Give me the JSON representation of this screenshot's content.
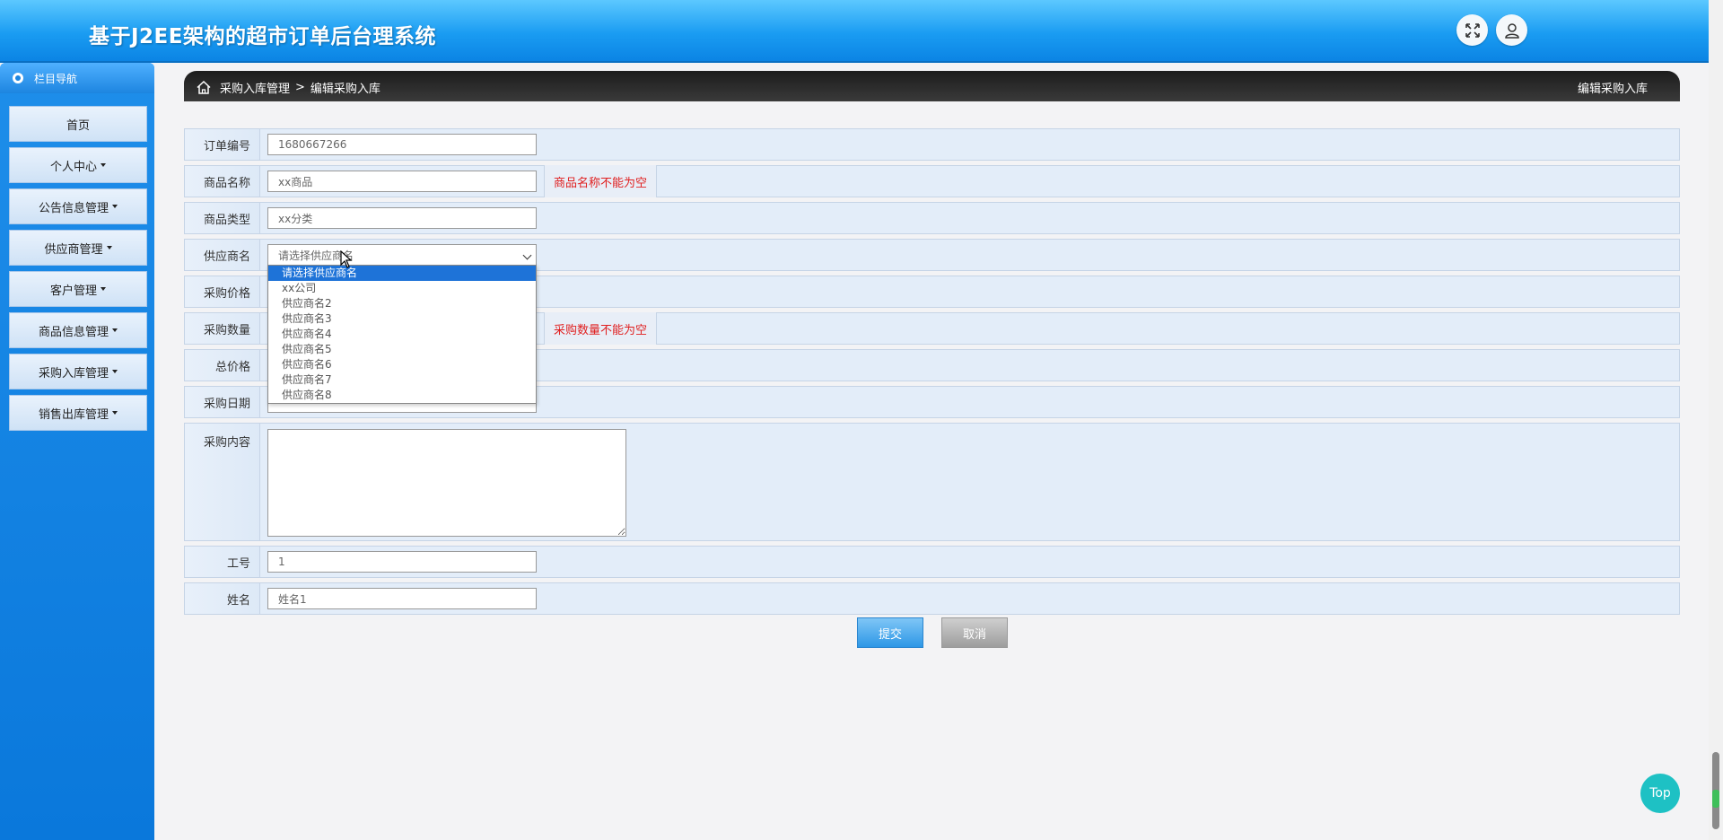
{
  "header": {
    "title": "基于J2EE架构的超市订单后台理系统",
    "fullscreen_icon": "expand-icon",
    "user_icon": "user-icon"
  },
  "sidebar": {
    "nav_title": "栏目导航",
    "items": [
      {
        "label": "首页",
        "has_caret": false
      },
      {
        "label": "个人中心",
        "has_caret": true
      },
      {
        "label": "公告信息管理",
        "has_caret": true
      },
      {
        "label": "供应商管理",
        "has_caret": true
      },
      {
        "label": "客户管理",
        "has_caret": true
      },
      {
        "label": "商品信息管理",
        "has_caret": true
      },
      {
        "label": "采购入库管理",
        "has_caret": true
      },
      {
        "label": "销售出库管理",
        "has_caret": true
      }
    ]
  },
  "breadcrumb": {
    "home_icon": "home-icon",
    "parent": "采购入库管理",
    "separator": ">",
    "current": "编辑采购入库",
    "right_title": "编辑采购入库"
  },
  "form": {
    "order_no": {
      "label": "订单编号",
      "value": "1680667266"
    },
    "product_name": {
      "label": "商品名称",
      "value": "xx商品",
      "error": "商品名称不能为空"
    },
    "product_type": {
      "label": "商品类型",
      "value": "xx分类"
    },
    "supplier": {
      "label": "供应商名",
      "value": "请选择供应商名",
      "options": [
        "请选择供应商名",
        "xx公司",
        "供应商名2",
        "供应商名3",
        "供应商名4",
        "供应商名5",
        "供应商名6",
        "供应商名7",
        "供应商名8"
      ]
    },
    "price": {
      "label": "采购价格",
      "value": ""
    },
    "quantity": {
      "label": "采购数量",
      "value": "",
      "error": "采购数量不能为空"
    },
    "total": {
      "label": "总价格",
      "value": ""
    },
    "date": {
      "label": "采购日期",
      "value": ""
    },
    "content": {
      "label": "采购内容",
      "value": ""
    },
    "job_no": {
      "label": "工号",
      "value": "1"
    },
    "name": {
      "label": "姓名",
      "value": "姓名1"
    }
  },
  "buttons": {
    "submit": "提交",
    "cancel": "取消",
    "top": "Top"
  },
  "colors": {
    "header_blue": "#1a9cf2",
    "sidebar_blue": "#0a78db",
    "error_red": "#e02020",
    "top_button": "#1ec1c4"
  }
}
